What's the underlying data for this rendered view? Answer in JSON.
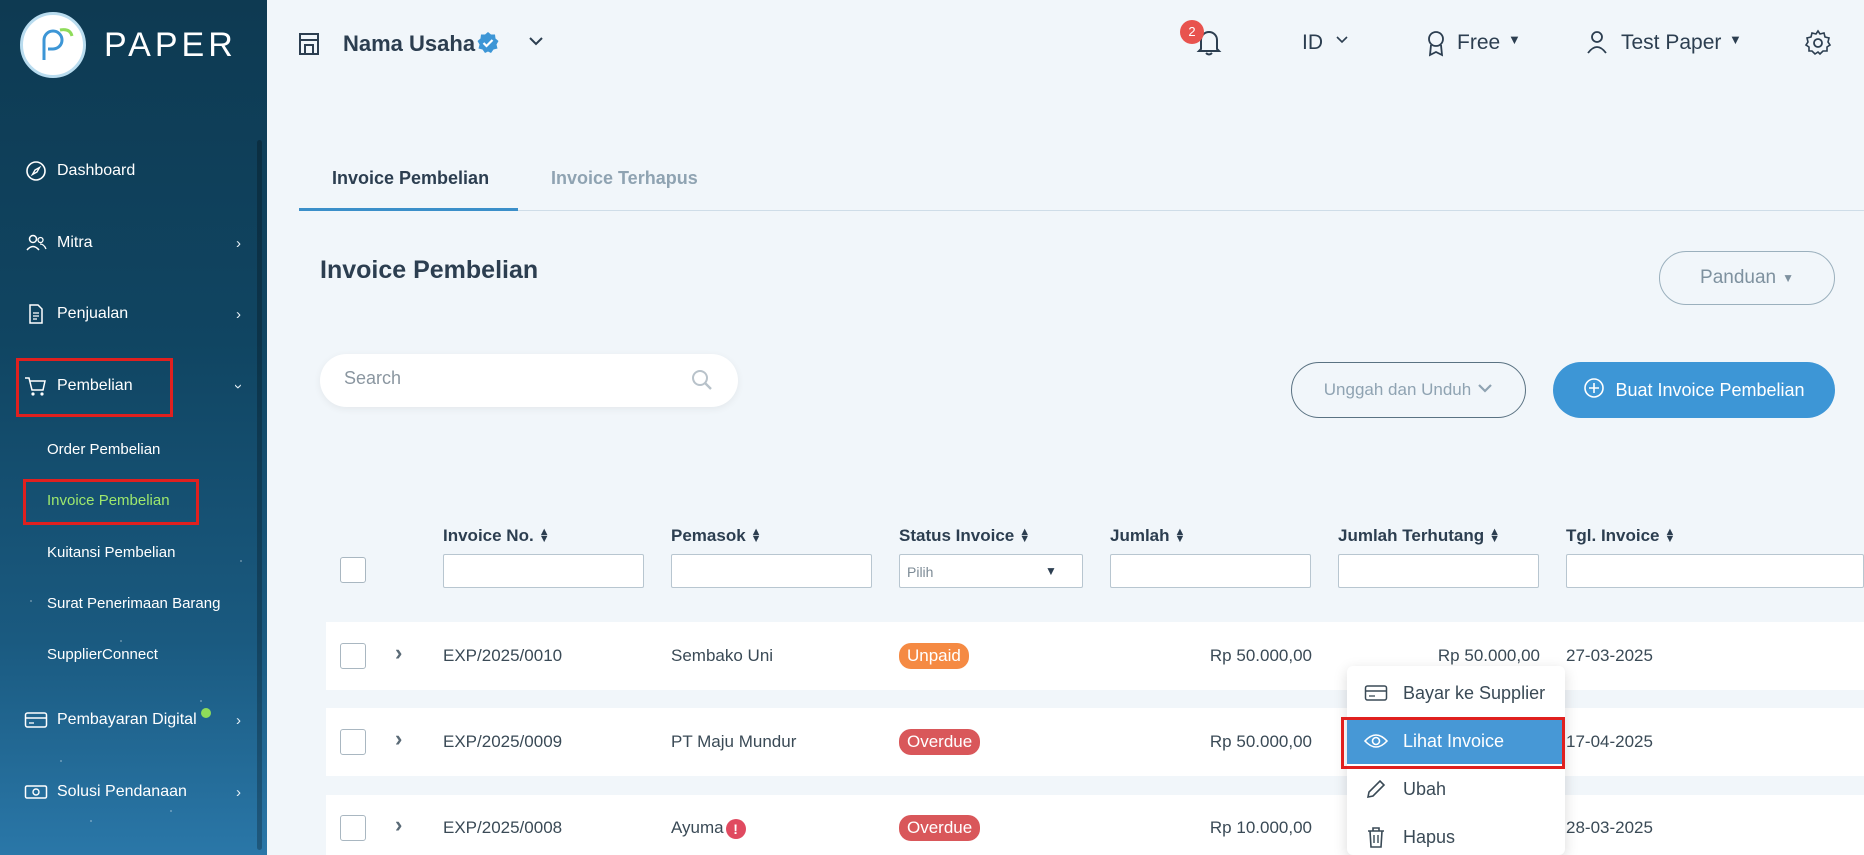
{
  "brand": {
    "name": "PAPER"
  },
  "sidebar": {
    "items": [
      {
        "label": "Dashboard",
        "icon": "compass-icon"
      },
      {
        "label": "Mitra",
        "icon": "users-icon"
      },
      {
        "label": "Penjualan",
        "icon": "document-icon"
      },
      {
        "label": "Pembelian",
        "icon": "cart-icon"
      },
      {
        "label": "Pembayaran Digital",
        "icon": "card-icon"
      },
      {
        "label": "Solusi Pendanaan",
        "icon": "money-icon"
      }
    ],
    "sub_items": [
      {
        "label": "Order Pembelian"
      },
      {
        "label": "Invoice Pembelian"
      },
      {
        "label": "Kuitansi Pembelian"
      },
      {
        "label": "Surat Penerimaan Barang"
      },
      {
        "label": "SupplierConnect"
      }
    ]
  },
  "header": {
    "business_name": "Nama Usaha",
    "notification_count": "2",
    "language": "ID",
    "plan": "Free",
    "user": "Test Paper"
  },
  "tabs": [
    {
      "label": "Invoice Pembelian"
    },
    {
      "label": "Invoice Terhapus"
    }
  ],
  "page": {
    "title": "Invoice Pembelian",
    "panduan_label": "Panduan",
    "search_placeholder": "Search",
    "upload_label": "Unggah dan Unduh",
    "create_label": "Buat Invoice Pembelian"
  },
  "table": {
    "columns": [
      "Invoice No.",
      "Pemasok",
      "Status Invoice",
      "Jumlah",
      "Jumlah Terhutang",
      "Tgl. Invoice"
    ],
    "status_placeholder": "Pilih",
    "rows": [
      {
        "invoice_no": "EXP/2025/0010",
        "supplier": "Sembako Uni",
        "status": "Unpaid",
        "amount": "Rp 50.000,00",
        "owed": "Rp 50.000,00",
        "date": "27-03-2025"
      },
      {
        "invoice_no": "EXP/2025/0009",
        "supplier": "PT Maju Mundur",
        "status": "Overdue",
        "amount": "Rp 50.000,00",
        "owed": "",
        "date": "17-04-2025"
      },
      {
        "invoice_no": "EXP/2025/0008",
        "supplier": "Ayuma",
        "status": "Overdue",
        "amount": "Rp 10.000,00",
        "owed": "",
        "date": "28-03-2025"
      }
    ]
  },
  "row_menu": {
    "items": [
      {
        "label": "Bayar ke Supplier"
      },
      {
        "label": "Lihat Invoice"
      },
      {
        "label": "Ubah"
      },
      {
        "label": "Hapus"
      }
    ]
  },
  "colors": {
    "accent": "#3d96d6",
    "highlight": "#e0201f",
    "unpaid": "#f58a43",
    "overdue": "#d9575a"
  }
}
